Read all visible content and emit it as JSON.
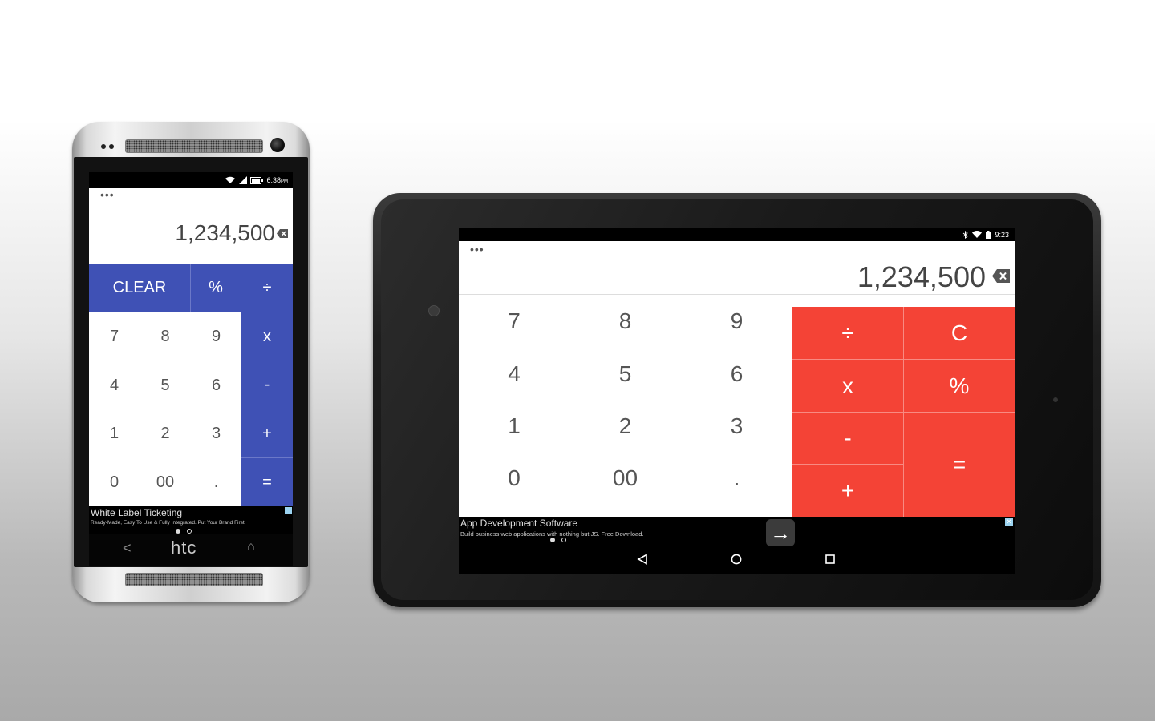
{
  "phone": {
    "brand": "htc",
    "status": {
      "time": "6:38",
      "ampm": "PM"
    },
    "display": {
      "menu": "•••",
      "value": "1,234,500"
    },
    "keys": {
      "clear": "CLEAR",
      "percent": "%",
      "divide": "÷",
      "multiply": "x",
      "minus": "-",
      "plus": "+",
      "equals": "=",
      "k7": "7",
      "k8": "8",
      "k9": "9",
      "k4": "4",
      "k5": "5",
      "k6": "6",
      "k1": "1",
      "k2": "2",
      "k3": "3",
      "k0": "0",
      "k00": "00",
      "dot": "."
    },
    "ad": {
      "title": "White Label Ticketing",
      "subtitle": "Ready-Made, Easy To Use & Fully Integrated. Put Your Brand First!"
    },
    "nav": {
      "back": "<",
      "home": "⌂"
    },
    "accent": "#3f51b5"
  },
  "tablet": {
    "status": {
      "time": "9:23"
    },
    "display": {
      "menu": "•••",
      "value": "1,234,500"
    },
    "keys": {
      "k7": "7",
      "k8": "8",
      "k9": "9",
      "k4": "4",
      "k5": "5",
      "k6": "6",
      "k1": "1",
      "k2": "2",
      "k3": "3",
      "k0": "0",
      "k00": "00",
      "dot": ".",
      "divide": "÷",
      "clear": "C",
      "multiply": "x",
      "percent": "%",
      "minus": "-",
      "plus": "+",
      "equals": "="
    },
    "ad": {
      "title": "App Development Software",
      "subtitle": "Build business web applications with nothing but JS. Free Download.",
      "close": "✕",
      "arrow": "→"
    },
    "accent": "#f44336"
  }
}
